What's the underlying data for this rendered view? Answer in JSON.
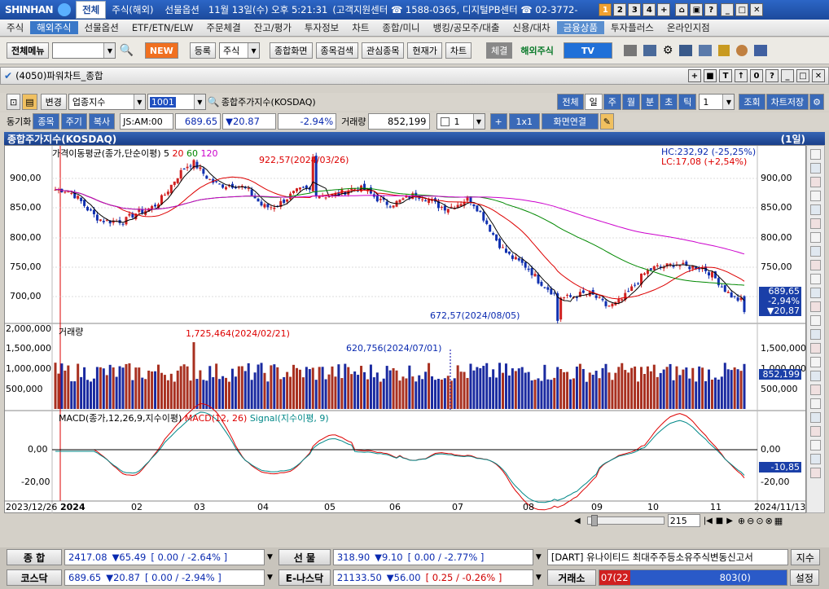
{
  "titlebar": {
    "logo": "SHINHAN",
    "tabs": [
      "전체",
      "주식(해외)",
      "선물옵션"
    ],
    "datetime": "11월 13일(수) 오후 5:21:31",
    "center": "(고객지원센터 ☎ 1588-0365, 디지털PB센터 ☎ 02-3772-",
    "num_tabs": [
      "1",
      "2",
      "3",
      "4",
      "+"
    ]
  },
  "menubar": [
    "주식",
    "해외주식",
    "선물옵션",
    "ETF/ETN/ELW",
    "주문체결",
    "잔고/평가",
    "투자정보",
    "차트",
    "종합/미니",
    "뱅킹/공모주/대출",
    "신용/대차",
    "금융상품",
    "투자플러스",
    "온라인지점"
  ],
  "toolbar": {
    "all_menu": "전체메뉴",
    "new": "NEW",
    "register": "등록",
    "stock": "주식",
    "buttons": [
      "종합화면",
      "종목검색",
      "관심종목",
      "현재가",
      "차트"
    ],
    "fill": "체결",
    "overseas": "해외주식",
    "tv": "TV"
  },
  "window": {
    "title": "(4050)파워차트_종합"
  },
  "ctrl1": {
    "change": "변경",
    "category": "업종지수",
    "code": "1001",
    "name": "종합주가지수(KOSDAQ)",
    "periods": [
      "전체",
      "일",
      "주",
      "월",
      "분",
      "초",
      "틱"
    ],
    "count": "1",
    "lookup": "조회",
    "save": "차트저장"
  },
  "ctrl2": {
    "sync": "동기화",
    "item": "종목",
    "cycle": "주기",
    "copy": "복사",
    "time": "JS:AM:00",
    "price": "689.65",
    "change": "▼20.87",
    "pct": "-2.94%",
    "vol_label": "거래량",
    "volume": "852,199",
    "cnt": "1",
    "plus": "+",
    "ratio": "1x1",
    "link": "화면연결"
  },
  "chart": {
    "header": "종합주가지수(KOSDAQ)",
    "header_period": "(1일)",
    "ma_label": "가격이동평균(종가,단순이평)",
    "ma_periods": [
      "5",
      "20",
      "60",
      "120"
    ],
    "hc": "HC:232,92 (-25,25%)",
    "lc": "LC:17,08 (+2,54%)",
    "high_note": "922,57(2024/03/26)",
    "low_note": "672,57(2024/08/05)",
    "price_ticks": [
      "900,00",
      "850,00",
      "800,00",
      "750,00",
      "700,00"
    ],
    "price_badge": [
      "689,65",
      "-2,94%",
      "▼20,87"
    ],
    "vol_label": "거래량",
    "vol_high": "1,725,464(2024/02/21)",
    "vol_mark": "620,756(2024/07/01)",
    "vol_ticks_left": [
      "2,000,000",
      "1,500,000",
      "1,000,000",
      "500,000"
    ],
    "vol_ticks_right": [
      "1,500,000",
      "1,000,000",
      "500,000"
    ],
    "vol_badge": "852,199",
    "macd_label": "MACD(종가,12,26,9,지수이평)",
    "macd_name": "MACD(12, 26)",
    "signal_name": "Signal(지수이평, 9)",
    "macd_ticks": [
      "0,00",
      "-20,00"
    ],
    "macd_badge": "-10,85",
    "x_labels": [
      "2023/12/26",
      "2024",
      "02",
      "03",
      "04",
      "05",
      "06",
      "07",
      "08",
      "09",
      "10",
      "11",
      "2024/11/13"
    ],
    "zoom": "215"
  },
  "chart_data": {
    "type": "line",
    "title": "종합주가지수(KOSDAQ)",
    "x": [
      "2024/01",
      "2024/02",
      "2024/03",
      "2024/04",
      "2024/05",
      "2024/06",
      "2024/07",
      "2024/08",
      "2024/09",
      "2024/10",
      "2024/11"
    ],
    "series": [
      {
        "name": "종합주가지수(KOSDAQ)",
        "values": [
          870,
          815,
          905,
          850,
          870,
          855,
          850,
          730,
          700,
          770,
          710
        ]
      }
    ],
    "high": 922.57,
    "low": 672.57,
    "last": 689.65,
    "ylim": [
      680,
      925
    ]
  },
  "status": {
    "r1": {
      "l1": "종 합",
      "v1": "2417.08",
      "c1": "▼65.49",
      "p1": "[ 0.00  / -2.64% ]",
      "l2": "선 물",
      "v2": "318.90",
      "c2": "▼9.10",
      "p2": "[ 0.00  / -2.77% ]",
      "news": "[DART] 유나이티드 최대주주등소유주식변동신고서",
      "btn": "지수"
    },
    "r2": {
      "l1": "코스닥",
      "v1": "689.65",
      "c1": "▼20.87",
      "p1": "[ 0.00  / -2.94% ]",
      "l2": "E-나스닥",
      "v2": "21133.50",
      "c2": "▼56.00",
      "p2": "[ 0.25  / -0.26% ]",
      "l3": "거래소",
      "t1": "07(22",
      "t2": "803(0)",
      "btn": "설정"
    }
  }
}
